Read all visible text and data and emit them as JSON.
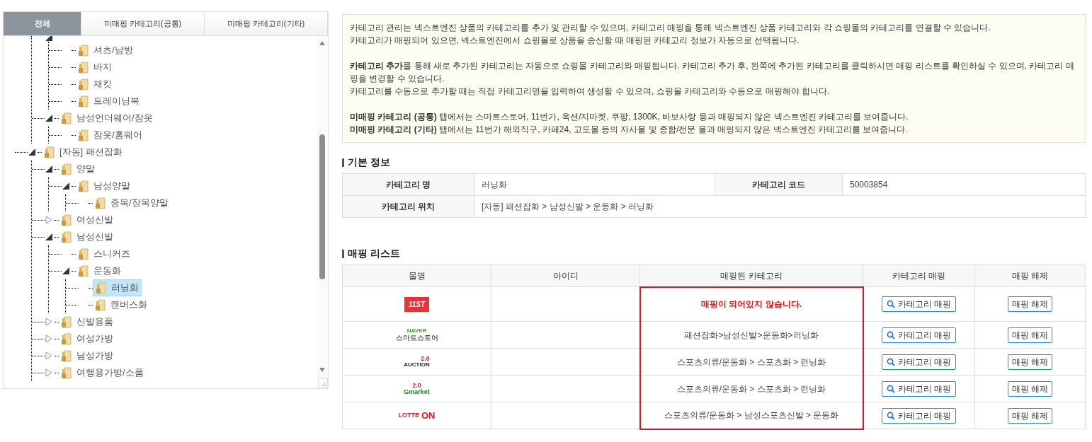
{
  "tabs": [
    {
      "label": "전체",
      "selected": true
    },
    {
      "label": "미매핑 카테고리(공통)",
      "selected": false
    },
    {
      "label": "미매핑 카테고리(기타)",
      "selected": false
    }
  ],
  "tree": [
    {
      "children": [
        {
          "expanded": true,
          "children": [
            {
              "label": "셔츠/남방",
              "selected": false
            },
            {
              "label": "바지",
              "selected": false
            },
            {
              "label": "재킷",
              "selected": false
            },
            {
              "label": "트레이닝복",
              "selected": false
            }
          ]
        },
        {
          "label": "남성언더웨어/잠옷",
          "expanded": true,
          "selected": false,
          "children": [
            {
              "label": "잠옷/홈웨어",
              "selected": false
            }
          ]
        }
      ]
    },
    {
      "label": "[자동] 패션잡화",
      "expanded": true,
      "selected": false,
      "children": [
        {
          "label": "양말",
          "expanded": true,
          "selected": false,
          "children": [
            {
              "label": "남성양말",
              "expanded": true,
              "selected": false,
              "children": [
                {
                  "label": "중목/장목양말",
                  "selected": false
                }
              ]
            }
          ]
        },
        {
          "label": "여성신발",
          "expanded": false,
          "selected": false
        },
        {
          "label": "남성신발",
          "expanded": true,
          "selected": false,
          "children": [
            {
              "label": "스니커즈",
              "selected": false
            },
            {
              "label": "운동화",
              "expanded": true,
              "selected": false,
              "children": [
                {
                  "label": "러닝화",
                  "selected": true
                },
                {
                  "label": "캔버스화",
                  "selected": false
                }
              ]
            }
          ]
        },
        {
          "label": "신발용품",
          "expanded": false,
          "selected": false
        },
        {
          "label": "여성가방",
          "expanded": false,
          "selected": false
        },
        {
          "label": "남성가방",
          "expanded": false,
          "selected": false
        },
        {
          "label": "여행용가방/소품",
          "expanded": false,
          "selected": false
        }
      ]
    }
  ],
  "notice": [
    [
      "카테고리 관리는 넥스트엔진 상품의 카테고리를 추가 및 관리할 수 있으며, 카테고리 매핑을 통해 넥스트엔진 상품 카테고리와 각 쇼핑몰의 카테고리를 연결할 수 있습니다.",
      "카테고리가 매핑되어 있으면, 넥스트엔진에서 쇼핑몰로 상품을 송신할 때 매핑된 카테고리 정보가 자동으로 선택됩니다."
    ],
    [
      "**카테고리 추가**를 통해 새로 추가된 카테고리는 자동으로 쇼핑몰 카테고리와 매핑됩니다. 카테고리 추가 후, 왼쪽에 추가된 카테고리를 클릭하시면 매핑 리스트를 확인하실 수 있으며, 카테고리 매핑을 변경할 수 있습니다.",
      "카테고리를 수동으로 추가할 때는 직접 카테고리명을 입력하여 생성할 수 있으며, 쇼핑몰 카테고리와 수동으로 매핑해야 합니다."
    ],
    [
      "**미매핑 카테고리 (공통)** 탭에서는 스마트스토어, 11번가, 옥션/지마켓, 쿠팡, 1300K, 바보사랑 등과 매핑되지 않은 넥스트엔진 카테고리를 보여줍니다.",
      "**미매핑 카테고리 (기타)** 탭에서는 11번가 해외직구, 카페24, 고도몰 등의 자사몰 및 종합/전문 몰과 매핑되지 않은 넥스트엔진 카테고리를 보여줍니다."
    ]
  ],
  "basic_info": {
    "title": "기본 정보",
    "name_label": "카테고리 명",
    "name": "러닝화",
    "code_label": "카테고리 코드",
    "code": "50003854",
    "path_label": "카테고리 위치",
    "path": "[자동] 패션잡화 > 남성신발 > 운동화 > 러닝화"
  },
  "mapping": {
    "title": "매핑 리스트",
    "columns": [
      "몰명",
      "아이디",
      "매핑된 카테고리",
      "카테고리 매핑",
      "매핑 해제"
    ],
    "rows": [
      {
        "kind": "elevenst",
        "logo": [
          "11ST"
        ],
        "mapped": false,
        "category": "매핑이 되어있지 않습니다.",
        "map_button": "카테고리 매핑",
        "unmap_button": "매핑 해제"
      },
      {
        "kind": "naver",
        "logo": [
          "NAVER",
          "스마트스토어"
        ],
        "mapped": true,
        "category": "패션잡화>남성신발>운동화>러닝화",
        "map_button": "카테고리 매핑",
        "unmap_button": "매핑 해제"
      },
      {
        "kind": "auction",
        "logo": [
          "2.0",
          "AUCTION"
        ],
        "mapped": true,
        "category": "스포츠의류/운동화 > 스포츠화 > 런닝화",
        "map_button": "카테고리 매핑",
        "unmap_button": "매핑 해제"
      },
      {
        "kind": "gmarket",
        "logo": [
          "2.0",
          "Gmarket"
        ],
        "mapped": true,
        "category": "스포츠의류/운동화 > 스포츠화 > 런닝화",
        "map_button": "카테고리 매핑",
        "unmap_button": "매핑 해제"
      },
      {
        "kind": "lotteon",
        "logo": [
          "LOTTE",
          "ON"
        ],
        "mapped": true,
        "category": "스포츠의류/운동화 > 남성스포츠신발 > 운동화",
        "map_button": "카테고리 매핑",
        "unmap_button": "매핑 해제"
      }
    ]
  }
}
